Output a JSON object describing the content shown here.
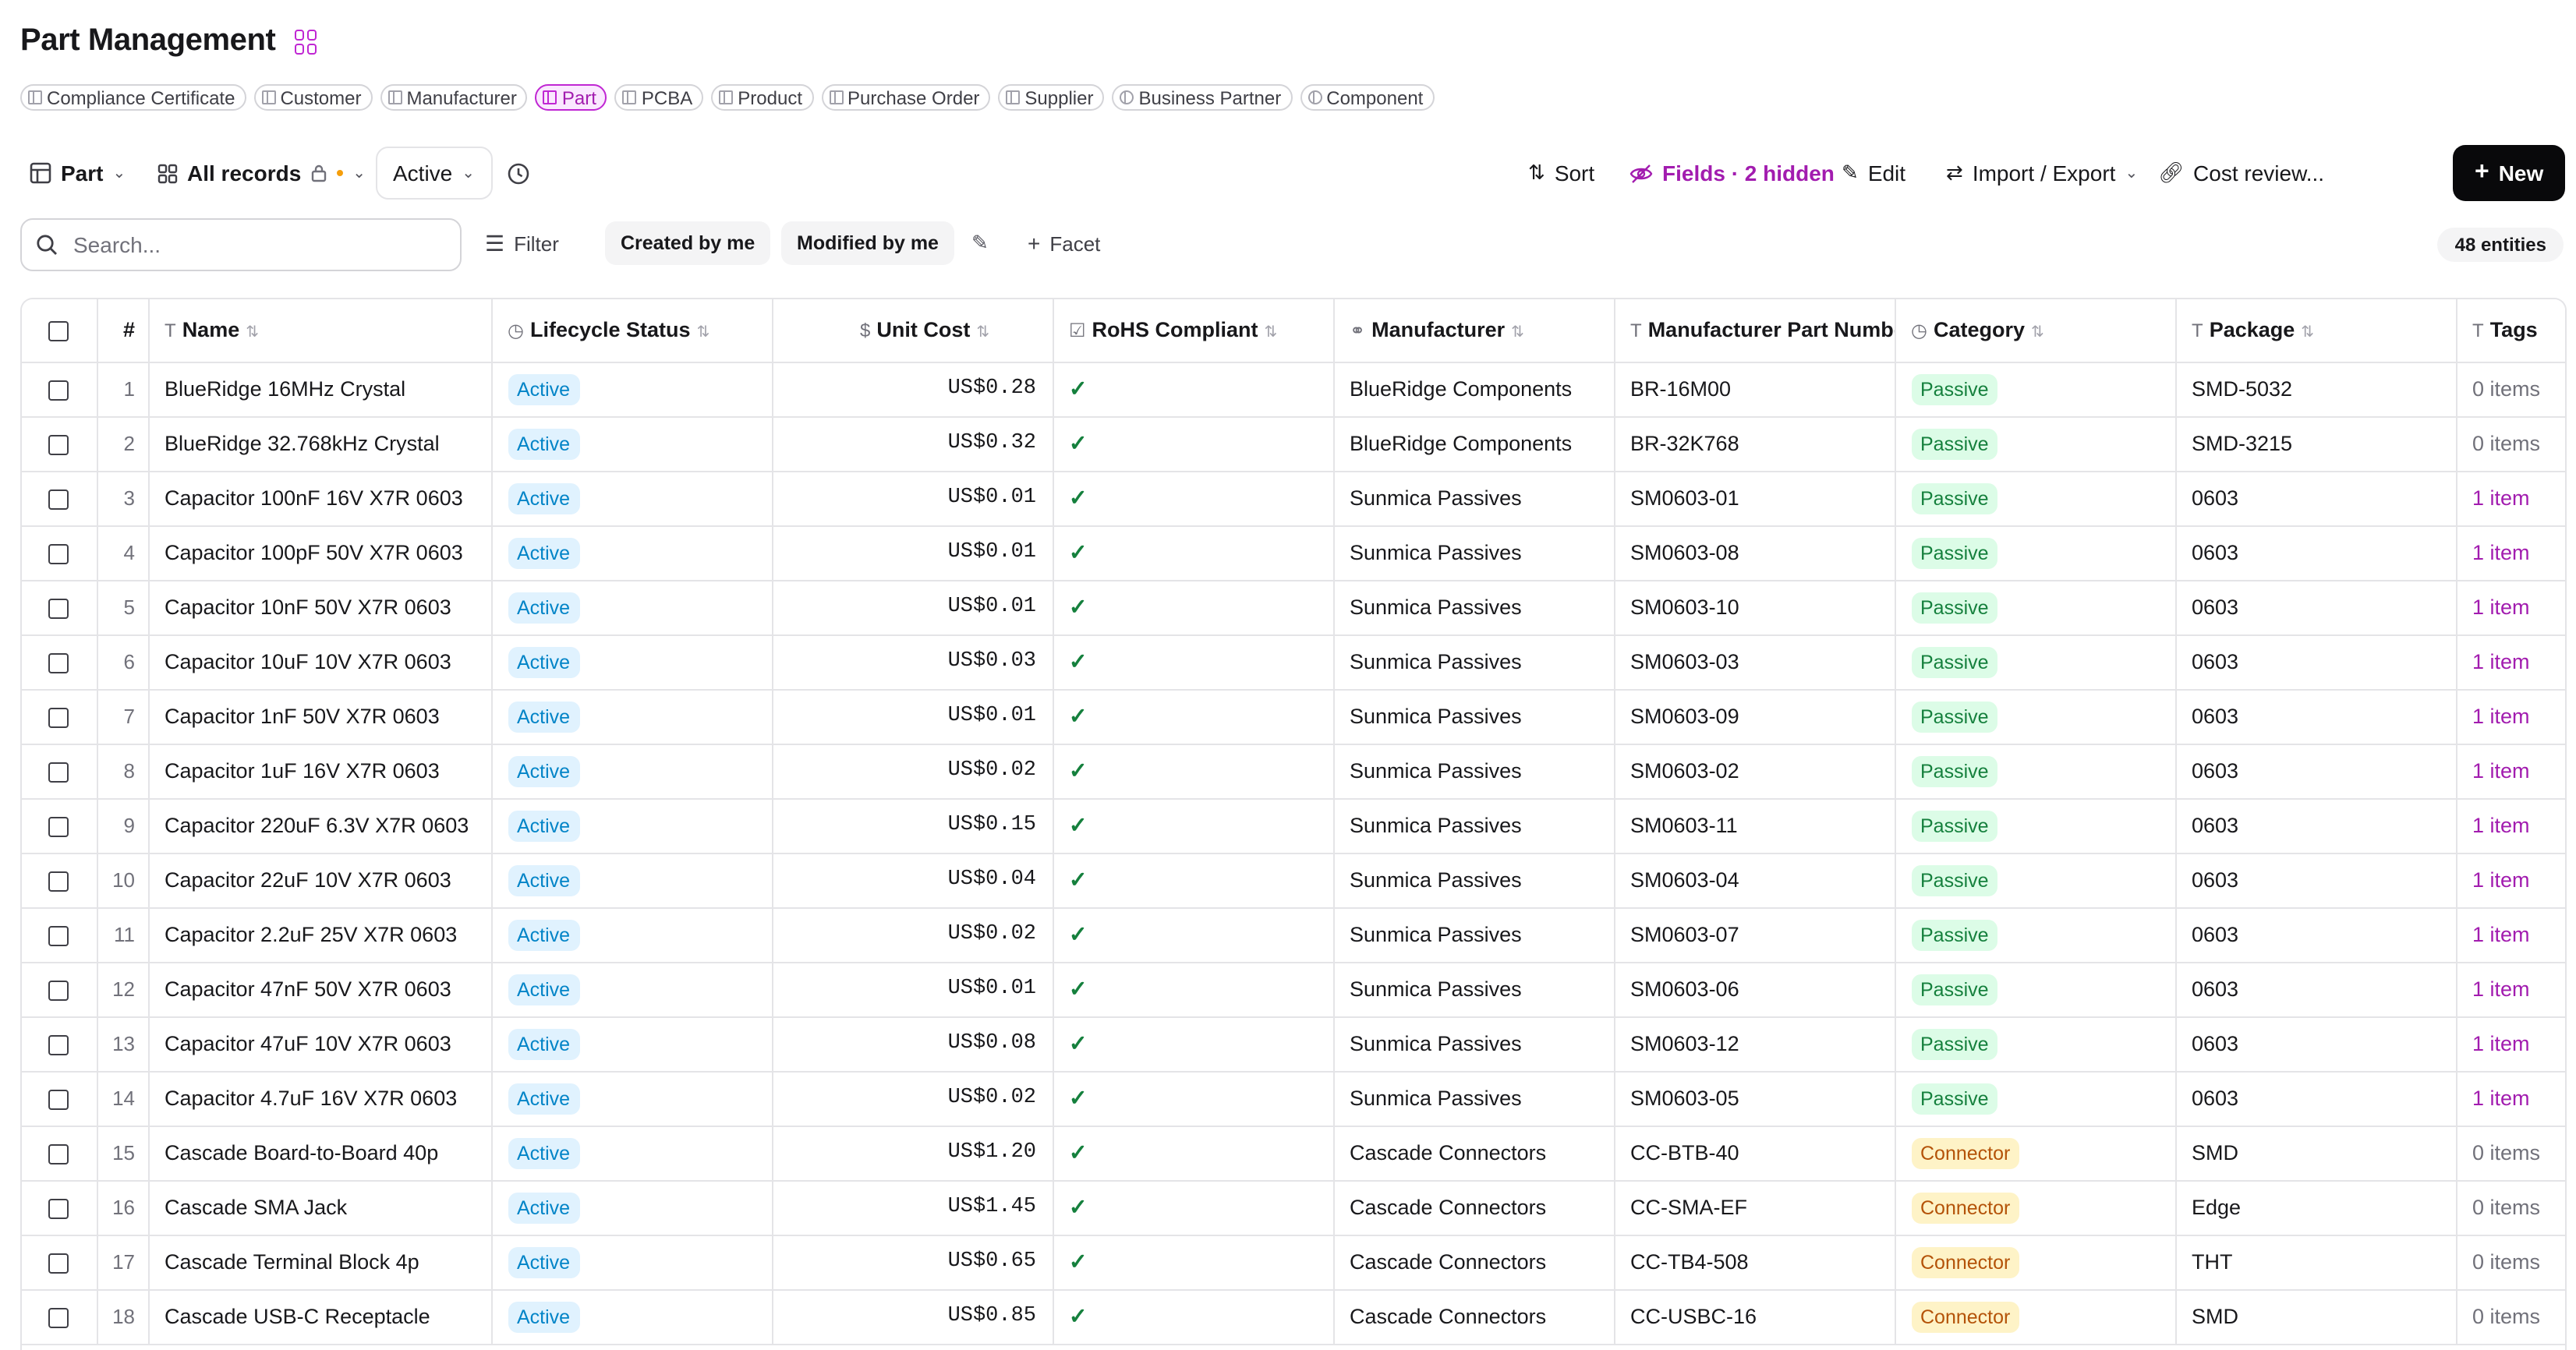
{
  "page_title": "Part Management",
  "entity_tabs": [
    {
      "label": "Compliance Certificate",
      "active": false
    },
    {
      "label": "Customer",
      "active": false
    },
    {
      "label": "Manufacturer",
      "active": false
    },
    {
      "label": "Part",
      "active": true
    },
    {
      "label": "PCBA",
      "active": false
    },
    {
      "label": "Product",
      "active": false
    },
    {
      "label": "Purchase Order",
      "active": false
    },
    {
      "label": "Supplier",
      "active": false
    },
    {
      "label": "Business Partner",
      "active": false
    },
    {
      "label": "Component",
      "active": false
    }
  ],
  "toolbar": {
    "entity_select": "Part",
    "view_select": "All records",
    "status_select": "Active",
    "sort": "Sort",
    "fields": "Fields · 2 hidden",
    "edit": "Edit",
    "import_export": "Import / Export",
    "cost_review": "Cost review...",
    "new": "New"
  },
  "filterbar": {
    "search_placeholder": "Search...",
    "filter": "Filter",
    "created_by_me": "Created by me",
    "modified_by_me": "Modified by me",
    "facet": "Facet",
    "entity_count": "48 entities"
  },
  "columns": [
    "#",
    "Name",
    "Lifecycle Status",
    "Unit Cost",
    "RoHS Compliant",
    "Manufacturer",
    "Manufacturer Part Number",
    "Category",
    "Package",
    "Tags"
  ],
  "rows": [
    {
      "n": "1",
      "name": "BlueRidge 16MHz Crystal",
      "status": "Active",
      "cost": "US$0.28",
      "rohs": "✓",
      "mfr": "BlueRidge Components",
      "mpn": "BR-16M00",
      "cat": "Passive",
      "pkg": "SMD-5032",
      "tags": "0 items"
    },
    {
      "n": "2",
      "name": "BlueRidge 32.768kHz Crystal",
      "status": "Active",
      "cost": "US$0.32",
      "rohs": "✓",
      "mfr": "BlueRidge Components",
      "mpn": "BR-32K768",
      "cat": "Passive",
      "pkg": "SMD-3215",
      "tags": "0 items"
    },
    {
      "n": "3",
      "name": "Capacitor 100nF 16V X7R 0603",
      "status": "Active",
      "cost": "US$0.01",
      "rohs": "✓",
      "mfr": "Sunmica Passives",
      "mpn": "SM0603-01",
      "cat": "Passive",
      "pkg": "0603",
      "tags": "1 item"
    },
    {
      "n": "4",
      "name": "Capacitor 100pF 50V X7R 0603",
      "status": "Active",
      "cost": "US$0.01",
      "rohs": "✓",
      "mfr": "Sunmica Passives",
      "mpn": "SM0603-08",
      "cat": "Passive",
      "pkg": "0603",
      "tags": "1 item"
    },
    {
      "n": "5",
      "name": "Capacitor 10nF 50V X7R 0603",
      "status": "Active",
      "cost": "US$0.01",
      "rohs": "✓",
      "mfr": "Sunmica Passives",
      "mpn": "SM0603-10",
      "cat": "Passive",
      "pkg": "0603",
      "tags": "1 item"
    },
    {
      "n": "6",
      "name": "Capacitor 10uF 10V X7R 0603",
      "status": "Active",
      "cost": "US$0.03",
      "rohs": "✓",
      "mfr": "Sunmica Passives",
      "mpn": "SM0603-03",
      "cat": "Passive",
      "pkg": "0603",
      "tags": "1 item"
    },
    {
      "n": "7",
      "name": "Capacitor 1nF 50V X7R 0603",
      "status": "Active",
      "cost": "US$0.01",
      "rohs": "✓",
      "mfr": "Sunmica Passives",
      "mpn": "SM0603-09",
      "cat": "Passive",
      "pkg": "0603",
      "tags": "1 item"
    },
    {
      "n": "8",
      "name": "Capacitor 1uF 16V X7R 0603",
      "status": "Active",
      "cost": "US$0.02",
      "rohs": "✓",
      "mfr": "Sunmica Passives",
      "mpn": "SM0603-02",
      "cat": "Passive",
      "pkg": "0603",
      "tags": "1 item"
    },
    {
      "n": "9",
      "name": "Capacitor 220uF 6.3V X7R 0603",
      "status": "Active",
      "cost": "US$0.15",
      "rohs": "✓",
      "mfr": "Sunmica Passives",
      "mpn": "SM0603-11",
      "cat": "Passive",
      "pkg": "0603",
      "tags": "1 item"
    },
    {
      "n": "10",
      "name": "Capacitor 22uF 10V X7R 0603",
      "status": "Active",
      "cost": "US$0.04",
      "rohs": "✓",
      "mfr": "Sunmica Passives",
      "mpn": "SM0603-04",
      "cat": "Passive",
      "pkg": "0603",
      "tags": "1 item"
    },
    {
      "n": "11",
      "name": "Capacitor 2.2uF 25V X7R 0603",
      "status": "Active",
      "cost": "US$0.02",
      "rohs": "✓",
      "mfr": "Sunmica Passives",
      "mpn": "SM0603-07",
      "cat": "Passive",
      "pkg": "0603",
      "tags": "1 item"
    },
    {
      "n": "12",
      "name": "Capacitor 47nF 50V X7R 0603",
      "status": "Active",
      "cost": "US$0.01",
      "rohs": "✓",
      "mfr": "Sunmica Passives",
      "mpn": "SM0603-06",
      "cat": "Passive",
      "pkg": "0603",
      "tags": "1 item"
    },
    {
      "n": "13",
      "name": "Capacitor 47uF 10V X7R 0603",
      "status": "Active",
      "cost": "US$0.08",
      "rohs": "✓",
      "mfr": "Sunmica Passives",
      "mpn": "SM0603-12",
      "cat": "Passive",
      "pkg": "0603",
      "tags": "1 item"
    },
    {
      "n": "14",
      "name": "Capacitor 4.7uF 16V X7R 0603",
      "status": "Active",
      "cost": "US$0.02",
      "rohs": "✓",
      "mfr": "Sunmica Passives",
      "mpn": "SM0603-05",
      "cat": "Passive",
      "pkg": "0603",
      "tags": "1 item"
    },
    {
      "n": "15",
      "name": "Cascade Board-to-Board 40p",
      "status": "Active",
      "cost": "US$1.20",
      "rohs": "✓",
      "mfr": "Cascade Connectors",
      "mpn": "CC-BTB-40",
      "cat": "Connector",
      "pkg": "SMD",
      "tags": "0 items"
    },
    {
      "n": "16",
      "name": "Cascade SMA Jack",
      "status": "Active",
      "cost": "US$1.45",
      "rohs": "✓",
      "mfr": "Cascade Connectors",
      "mpn": "CC-SMA-EF",
      "cat": "Connector",
      "pkg": "Edge",
      "tags": "0 items"
    },
    {
      "n": "17",
      "name": "Cascade Terminal Block 4p",
      "status": "Active",
      "cost": "US$0.65",
      "rohs": "✓",
      "mfr": "Cascade Connectors",
      "mpn": "CC-TB4-508",
      "cat": "Connector",
      "pkg": "THT",
      "tags": "0 items"
    },
    {
      "n": "18",
      "name": "Cascade USB-C Receptacle",
      "status": "Active",
      "cost": "US$0.85",
      "rohs": "✓",
      "mfr": "Cascade Connectors",
      "mpn": "CC-USBC-16",
      "cat": "Connector",
      "pkg": "SMD",
      "tags": "0 items"
    }
  ],
  "colors": {
    "accent": "#a21caf",
    "active_badge": "#0284c7",
    "passive_badge": "#15803d",
    "connector_badge": "#b45309"
  }
}
